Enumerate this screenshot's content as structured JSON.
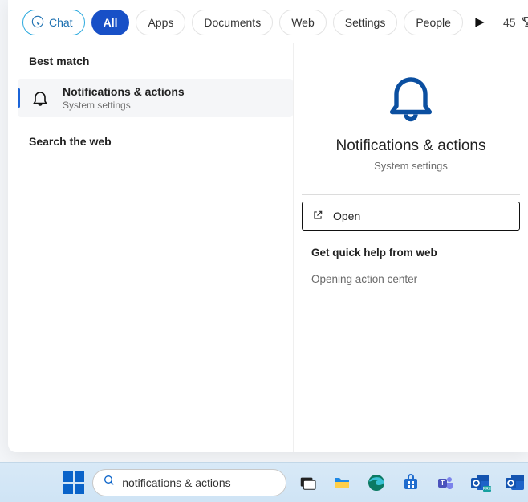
{
  "tabs": {
    "chat": "Chat",
    "all": "All",
    "apps": "Apps",
    "documents": "Documents",
    "web": "Web",
    "settings": "Settings",
    "people": "People"
  },
  "points": {
    "count": "45"
  },
  "left": {
    "best_match": "Best match",
    "result": {
      "title": "Notifications & actions",
      "subtitle": "System settings"
    },
    "search_web": "Search the web"
  },
  "right": {
    "title": "Notifications & actions",
    "subtitle": "System settings",
    "open": "Open",
    "help_header": "Get quick help from web",
    "link1": "Opening action center"
  },
  "taskbar": {
    "search_value": "notifications & actions"
  }
}
